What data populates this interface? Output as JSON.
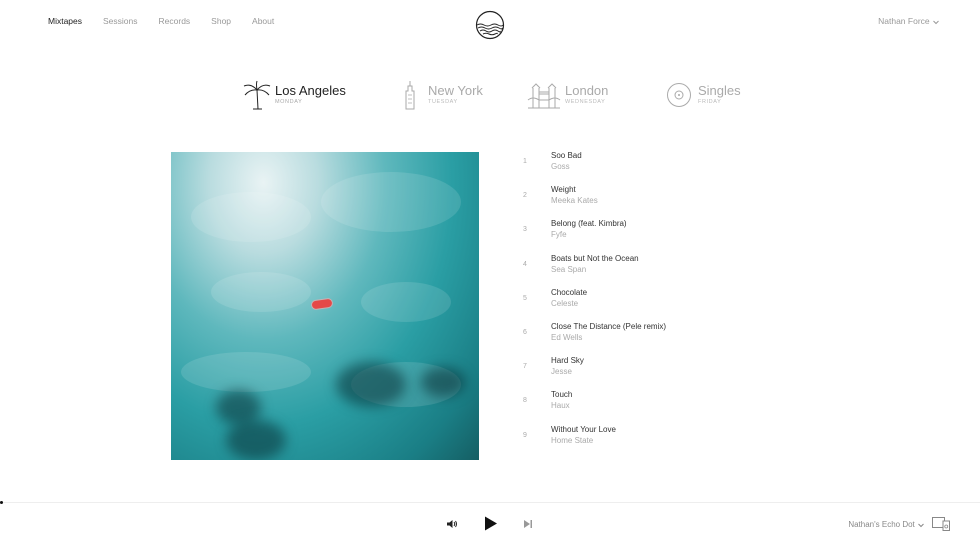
{
  "nav": {
    "items": [
      {
        "label": "Mixtapes",
        "active": true
      },
      {
        "label": "Sessions",
        "active": false
      },
      {
        "label": "Records",
        "active": false
      },
      {
        "label": "Shop",
        "active": false
      },
      {
        "label": "About",
        "active": false
      }
    ],
    "logo_icon": "waves-circle-logo",
    "user_name": "Nathan Force"
  },
  "cities": [
    {
      "name": "Los Angeles",
      "day": "MONDAY",
      "icon": "palm-tree-icon",
      "active": true
    },
    {
      "name": "New York",
      "day": "TUESDAY",
      "icon": "empire-state-icon",
      "active": false
    },
    {
      "name": "London",
      "day": "WEDNESDAY",
      "icon": "tower-bridge-icon",
      "active": false
    },
    {
      "name": "Singles",
      "day": "FRIDAY",
      "icon": "vinyl-disc-icon",
      "active": false
    }
  ],
  "tracks": [
    {
      "num": "1",
      "title": "Soo Bad",
      "artist": "Goss"
    },
    {
      "num": "2",
      "title": "Weight",
      "artist": "Meeka Kates"
    },
    {
      "num": "3",
      "title": "Belong (feat. Kimbra)",
      "artist": "Fyfe"
    },
    {
      "num": "4",
      "title": "Boats but Not the Ocean",
      "artist": "Sea Span"
    },
    {
      "num": "5",
      "title": "Chocolate",
      "artist": "Celeste"
    },
    {
      "num": "6",
      "title": "Close The Distance (Pele remix)",
      "artist": "Ed Wells"
    },
    {
      "num": "7",
      "title": "Hard Sky",
      "artist": "Jesse"
    },
    {
      "num": "8",
      "title": "Touch",
      "artist": "Haux"
    },
    {
      "num": "9",
      "title": "Without Your Love",
      "artist": "Home State"
    }
  ],
  "player": {
    "device": "Nathan's Echo Dot",
    "controls": [
      "volume-icon",
      "play-icon",
      "next-icon"
    ]
  },
  "colors": {
    "accent_text": "#222222",
    "muted_text": "#999999",
    "boat": "#e54848",
    "water": "#2a9ea4"
  }
}
